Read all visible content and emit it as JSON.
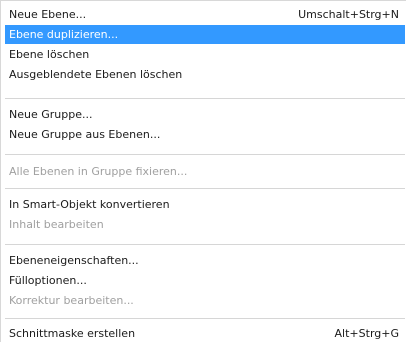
{
  "menu": {
    "items": [
      {
        "label": "Neue Ebene...",
        "shortcut": "Umschalt+Strg+N"
      },
      {
        "label": "Ebene duplizieren...",
        "state": "highlighted"
      },
      {
        "label": "Ebene löschen"
      },
      {
        "label": "Ausgeblendete Ebenen löschen"
      },
      {
        "label": "Neue Gruppe..."
      },
      {
        "label": "Neue Gruppe aus Ebenen..."
      },
      {
        "label": "Alle Ebenen in Gruppe fixieren...",
        "state": "disabled"
      },
      {
        "label": "In Smart-Objekt konvertieren"
      },
      {
        "label": "Inhalt bearbeiten",
        "state": "disabled"
      },
      {
        "label": "Ebeneneigenschaften..."
      },
      {
        "label": "Fülloptionen..."
      },
      {
        "label": "Korrektur bearbeiten...",
        "state": "disabled"
      },
      {
        "label": "Schnittmaske erstellen",
        "shortcut": "Alt+Strg+G"
      }
    ]
  },
  "colors": {
    "highlight": "#3399ff",
    "highlight_text": "#ffffff",
    "disabled_text": "#a0a0a0",
    "separator": "#d6d6d6"
  }
}
